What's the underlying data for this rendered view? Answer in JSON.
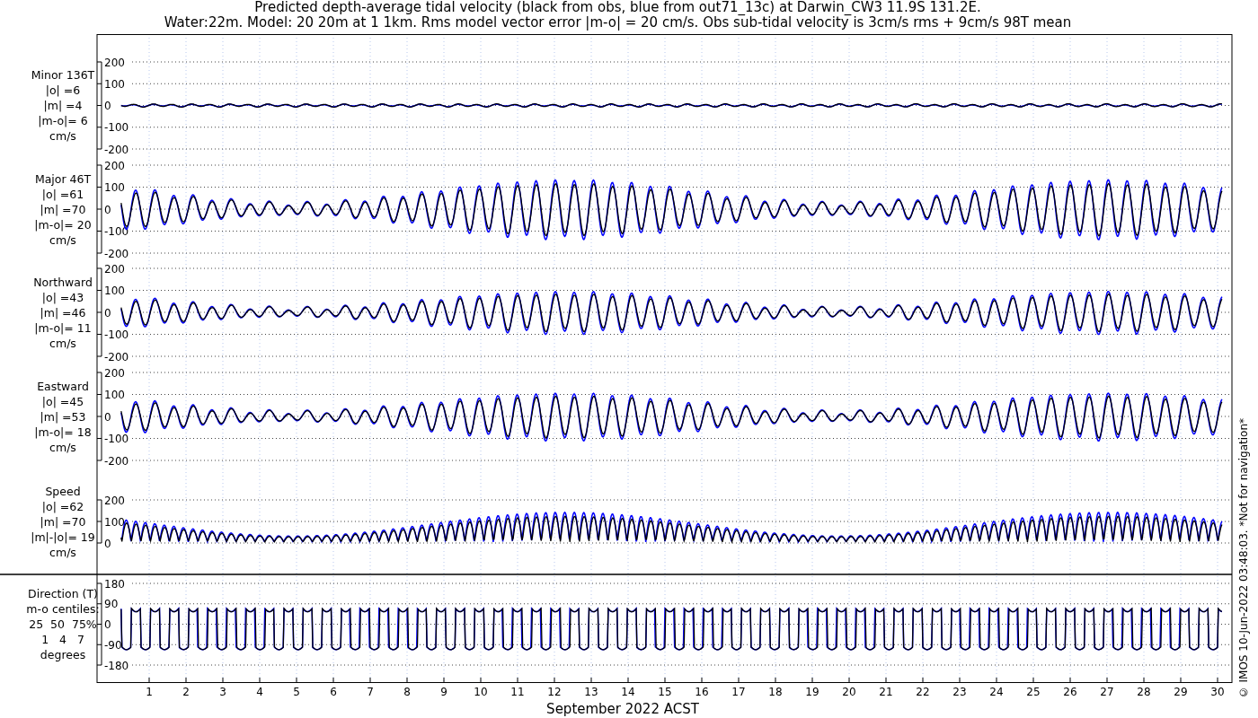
{
  "title": [
    "Predicted depth-average tidal velocity (black from obs, blue from out71_13c) at Darwin_CW3 11.9S 131.2E.",
    "Water:22m. Model: 20 20m at 1 1km. Rms model vector error |m-o| = 20 cm/s. Obs sub-tidal velocity is 3cm/s rms + 9cm/s 98T mean"
  ],
  "panels": [
    {
      "kind": "minor",
      "label": [
        "Minor 136T",
        "|o| =6",
        "|m| =4",
        "|m-o|= 6",
        "cm/s"
      ],
      "yticks": [
        "200",
        "100",
        "0",
        "-100",
        "-200"
      ]
    },
    {
      "kind": "velocity",
      "label": [
        "Major 46T",
        "|o| =61",
        "|m| =70",
        "|m-o|= 20",
        "cm/s"
      ],
      "yticks": [
        "200",
        "100",
        "0",
        "-100",
        "-200"
      ]
    },
    {
      "kind": "velocity",
      "label": [
        "Northward",
        "|o| =43",
        "|m| =46",
        "|m-o|= 11",
        "cm/s"
      ],
      "yticks": [
        "200",
        "100",
        "0",
        "-100",
        "-200"
      ]
    },
    {
      "kind": "velocity",
      "label": [
        "Eastward",
        "|o| =45",
        "|m| =53",
        "|m-o|= 18",
        "cm/s"
      ],
      "yticks": [
        "200",
        "100",
        "0",
        "-100",
        "-200"
      ]
    },
    {
      "kind": "speed",
      "label": [
        "Speed",
        "|o| =62",
        "|m| =70",
        "|m|-|o|= 19",
        "cm/s"
      ],
      "yticks": [
        "200",
        "100",
        "0"
      ]
    },
    {
      "kind": "direction",
      "label": [
        "Direction (T)",
        "m-o centiles:",
        "25  50  75%",
        "1   4   7",
        "degrees"
      ],
      "yticks": [
        "180",
        "90",
        "0",
        "-90",
        "-180"
      ]
    }
  ],
  "xticks": [
    "1",
    "2",
    "3",
    "4",
    "5",
    "6",
    "7",
    "8",
    "9",
    "10",
    "11",
    "12",
    "13",
    "14",
    "15",
    "16",
    "17",
    "18",
    "19",
    "20",
    "21",
    "22",
    "23",
    "24",
    "25",
    "26",
    "27",
    "28",
    "29",
    "30"
  ],
  "xlabel": "September 2022 ACST",
  "side_note": "© IMOS 10-Jun-2022 03:48:03. *Not for navigation*"
}
